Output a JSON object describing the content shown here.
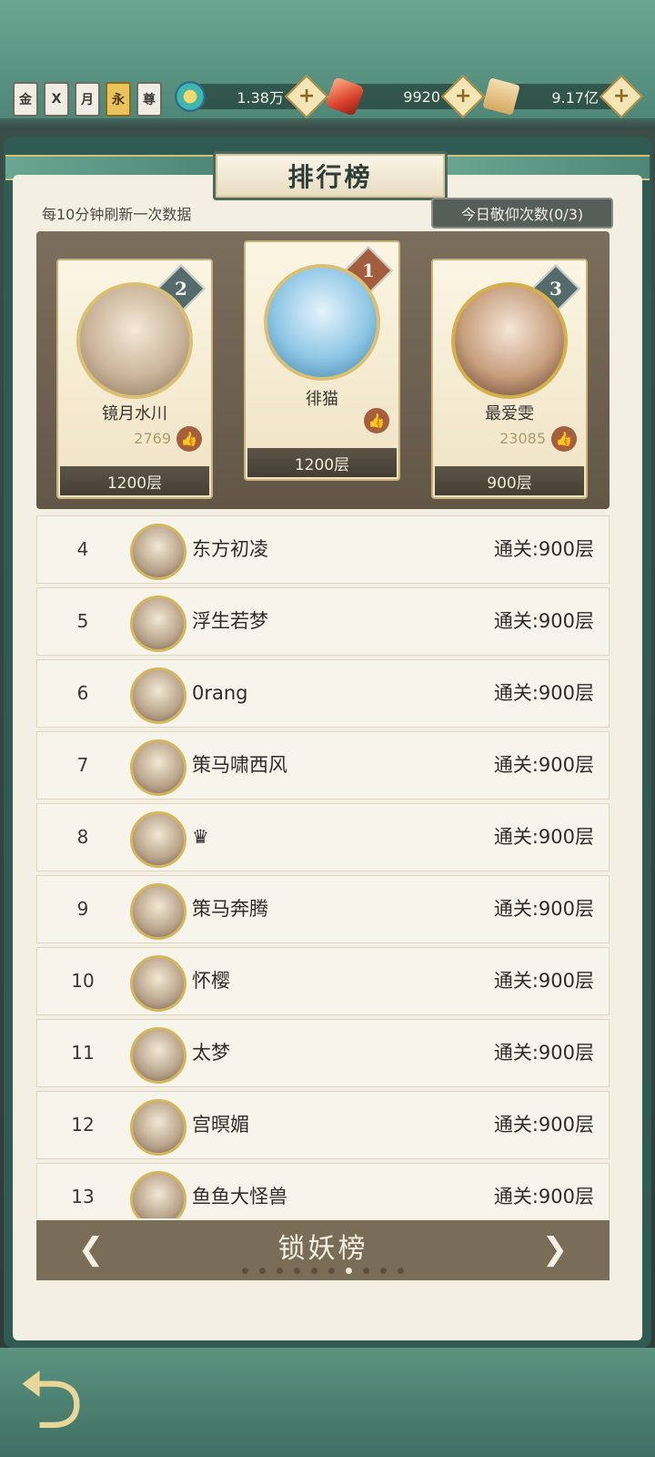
{
  "topbar": {
    "badges": [
      "金",
      "X",
      "月",
      "永",
      "尊"
    ],
    "resources": [
      {
        "name": "spirit-coin",
        "value": "1.38万"
      },
      {
        "name": "red-crystal",
        "value": "9920"
      },
      {
        "name": "scroll-ticket",
        "value": "9.17亿"
      }
    ]
  },
  "panel": {
    "title": "排行榜",
    "refresh_note": "每10分钟刷新一次数据",
    "worship_label": "今日敬仰次数(0/3)"
  },
  "podium": {
    "first": {
      "rank": "1",
      "name": "徘猫",
      "floor": "1200层"
    },
    "second": {
      "rank": "2",
      "name": "镜月水川",
      "likes": "2769",
      "floor": "1200层"
    },
    "third": {
      "rank": "3",
      "name": "最爱雯",
      "likes": "23085",
      "floor": "900层"
    }
  },
  "list": [
    {
      "rank": "4",
      "name": "东方初凌",
      "result": "通关:900层"
    },
    {
      "rank": "5",
      "name": "浮生若梦",
      "result": "通关:900层"
    },
    {
      "rank": "6",
      "name": "0rang",
      "result": "通关:900层"
    },
    {
      "rank": "7",
      "name": "策马啸西风",
      "result": "通关:900层"
    },
    {
      "rank": "8",
      "name": "♛",
      "result": "通关:900层"
    },
    {
      "rank": "9",
      "name": "策马奔腾",
      "result": "通关:900层"
    },
    {
      "rank": "10",
      "name": "怀樱",
      "result": "通关:900层"
    },
    {
      "rank": "11",
      "name": "太梦",
      "result": "通关:900层"
    },
    {
      "rank": "12",
      "name": "宫暝媚",
      "result": "通关:900层"
    },
    {
      "rank": "13",
      "name": "鱼鱼大怪兽",
      "result": "通关:900层"
    }
  ],
  "tabbar": {
    "title": "锁妖榜",
    "page_count": 10,
    "active_page": 6
  },
  "colors": {
    "accent_teal": "#4f8777",
    "panel_bg": "#f3efe3",
    "gold": "#d5b65c"
  }
}
